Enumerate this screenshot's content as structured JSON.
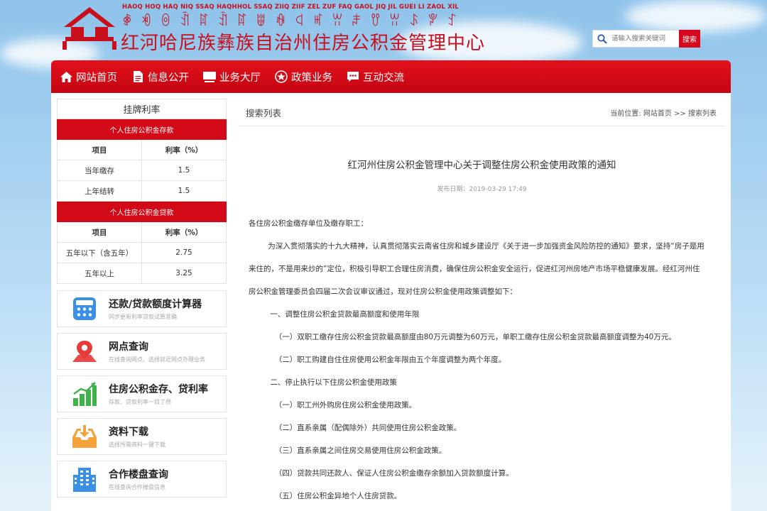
{
  "header": {
    "yi_roman": "HAOQ HOQ HAQ NIQ SSAQ HAQHHOL SSAQ ZIIQ ZIIF ZEL ZUF FAQ GAOL JIQ JIL GUEI LI ZAOL XIL",
    "yi_script": "ꑸ ꏓ ꉻ ꀉ ꍏ ꀉ ꍏ ꍔ ꊿ ꒉ ꎭ ꀕ ꌧ ꀎ ꀕ ꌺ ꐕ ꉘ",
    "site_name": "红河哈尼族彝族自治州住房公积金管理中心",
    "brand_color": "#c8101d"
  },
  "search": {
    "placeholder": "请输入搜索关键词",
    "button_label": "搜索",
    "icon": "search-icon"
  },
  "nav": {
    "items": [
      {
        "label": "网站首页",
        "icon": "home-icon"
      },
      {
        "label": "信息公开",
        "icon": "document-icon"
      },
      {
        "label": "业务大厅",
        "icon": "monitor-icon"
      },
      {
        "label": "政策业务",
        "icon": "star-badge-icon"
      },
      {
        "label": "互动交流",
        "icon": "chat-icon"
      }
    ]
  },
  "rates": {
    "title": "挂牌利率",
    "deposit": {
      "header": "个人住房公积金存款",
      "col1": "项目",
      "col2": "利率（%）",
      "rows": [
        {
          "item": "当年缴存",
          "rate": "1.5"
        },
        {
          "item": "上年结转",
          "rate": "1.5"
        }
      ]
    },
    "loan": {
      "header": "个人住房公积金贷款",
      "col1": "项目",
      "col2": "利率（%）",
      "rows": [
        {
          "item": "五年以下（含五年）",
          "rate": "2.75"
        },
        {
          "item": "五年以上",
          "rate": "3.25"
        }
      ]
    }
  },
  "services": [
    {
      "title": "还款/贷款额度计算器",
      "subtitle": "同步更新利率贷款试算准确",
      "icon": "calculator-icon"
    },
    {
      "title": "网点查询",
      "subtitle": "在线查询网点、选择就近网点办理业务",
      "icon": "map-pin-icon"
    },
    {
      "title": "住房公积金存、贷利率",
      "subtitle": "存款、贷款利率一目了然",
      "icon": "bar-chart-icon"
    },
    {
      "title": "资料下载",
      "subtitle": "选择所需资料一键下载",
      "icon": "download-tray-icon"
    },
    {
      "title": "合作楼盘查询",
      "subtitle": "在线查询合作楼盘信息",
      "icon": "building-icon"
    }
  ],
  "main": {
    "list_title": "搜索列表",
    "breadcrumb": {
      "label": "当前位置:",
      "home": "网站首页",
      "sep": ">>",
      "current": "搜索列表"
    },
    "article": {
      "title": "红河州住房公积金管理中心关于调整住房公积金使用政策的通知",
      "date": "发布日期：2019-03-29 17:49",
      "salutation": "各住房公积金缴存单位及缴存职工：",
      "intro": "为深入贯彻落实的十九大精神，认真贯彻落实云南省住房和城乡建设厅《关于进一步加强资金风险防控的通知》要求，坚持“房子是用来住的，不是用来炒的”定位，积极引导职工合理住房消费，确保住房公积金安全运行，促进红河州房地产市场平稳健康发展。经红河州住房公积金管理委员会四届二次会议审议通过，现对住房公积金使用政策调整如下：",
      "section1": "一、调整住房公积金贷款最高额度和使用年限",
      "s1_items": [
        "（一）双职工缴存住房公积金贷款最高额度由80万元调整为60万元，单职工缴存住房公积金贷款最高额度调整为40万元。",
        "（二）职工购建自住住房使用公积金年限由五个年度调整为两个年度。"
      ],
      "section2": "二、停止执行以下住房公积金使用政策",
      "s2_items": [
        "（一）职工州外购房住房公积金使用政策。",
        "（二）直系亲属（配偶除外）共同使用住房公积金政策。",
        "（三）直系亲属之间住房交易使用住房公积金政策。",
        "（四）贷款共同还款人、保证人住房公积金缴存余额加入贷款额度计算。",
        "（五）住房公积金异地个人住房贷款。"
      ]
    }
  }
}
